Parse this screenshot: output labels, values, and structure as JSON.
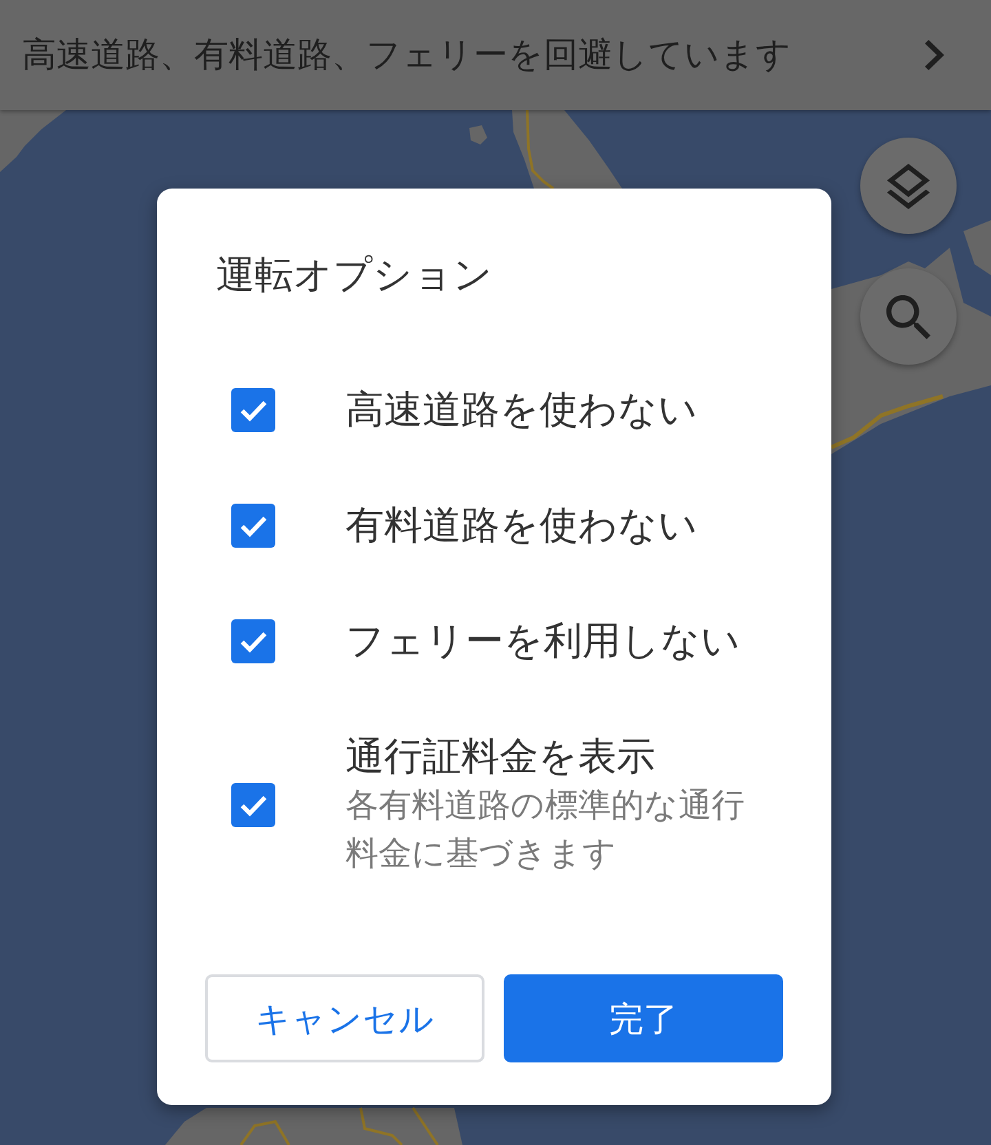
{
  "banner": {
    "text": "高速道路、有料道路、フェリーを回避しています"
  },
  "dialog": {
    "title": "運転オプション",
    "options": [
      {
        "label": "高速道路を使わない",
        "checked": true
      },
      {
        "label": "有料道路を使わない",
        "checked": true
      },
      {
        "label": "フェリーを利用しない",
        "checked": true
      },
      {
        "label": "通行証料金を表示",
        "description": "各有料道路の標準的な通行料金に基づきます",
        "checked": true
      }
    ],
    "buttons": [
      {
        "label": "キャンセル",
        "kind": "secondary"
      },
      {
        "label": "完了",
        "kind": "primary"
      }
    ]
  }
}
